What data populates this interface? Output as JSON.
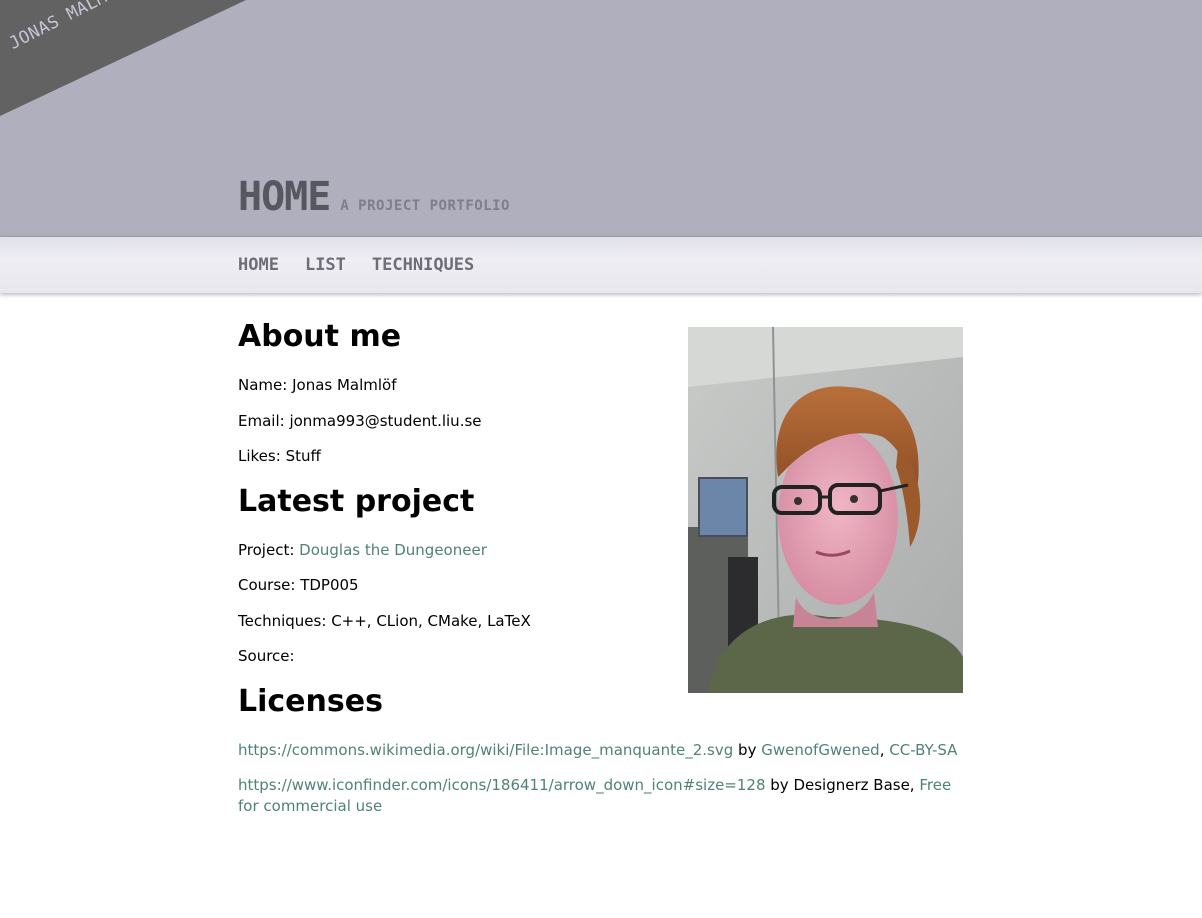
{
  "corner": {
    "name": "JONAS MALMLÖF"
  },
  "header": {
    "title": "HOME",
    "subtitle": "A PROJECT PORTFOLIO"
  },
  "nav": {
    "items": [
      "HOME",
      "LIST",
      "TECHNIQUES"
    ]
  },
  "about": {
    "heading": "About me",
    "name_label": "Name:",
    "name_value": "Jonas Malmlöf",
    "email_label": "Email:",
    "email_value": "jonma993@student.liu.se",
    "likes_label": "Likes:",
    "likes_value": "Stuff"
  },
  "project": {
    "heading": "Latest project",
    "project_label": "Project:",
    "project_link": "Douglas the Dungeoneer",
    "course_label": "Course:",
    "course_value": "TDP005",
    "techniques_label": "Techniques:",
    "techniques_value": "C++, CLion, CMake, LaTeX",
    "source_label": "Source:"
  },
  "licenses": {
    "heading": "Licenses",
    "item1": {
      "link": "https://commons.wikimedia.org/wiki/File:Image_manquante_2.svg",
      "by": "by",
      "author": "GwenofGwened",
      "sep": ",",
      "license": "CC-BY-SA"
    },
    "item2": {
      "link": "https://www.iconfinder.com/icons/186411/arrow_down_icon#size=128",
      "by_author": "by Designerz Base,",
      "license": "Free for commercial use"
    }
  },
  "colors": {
    "header_bg": "#b0afbe",
    "banner": "#626262",
    "link": "#4f8278",
    "nav_text": "#6e6d78"
  }
}
